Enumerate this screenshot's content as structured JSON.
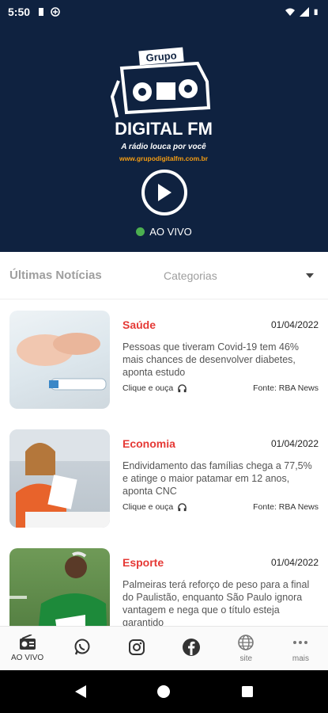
{
  "status_bar": {
    "time": "5:50"
  },
  "header": {
    "logo_text": "Grupo DIGITAL FM A rádio louca por você www.grupodigitalfm.com.br",
    "live_label": "AO VIVO"
  },
  "news_section": {
    "title": "Últimas Notícias",
    "categories_label": "Categorias"
  },
  "news": [
    {
      "category": "Saúde",
      "date": "01/04/2022",
      "text": "Pessoas que tiveram Covid-19 tem 46% mais chances de desenvolver diabetes, aponta estudo",
      "listen_label": "Clique e ouça",
      "source": "Fonte: RBA News"
    },
    {
      "category": "Economia",
      "date": "01/04/2022",
      "text": "Endividamento das famílias chega a 77,5% e atinge o maior patamar em 12 anos, aponta CNC",
      "listen_label": "Clique e ouça",
      "source": "Fonte: RBA News"
    },
    {
      "category": "Esporte",
      "date": "01/04/2022",
      "text": "Palmeiras terá reforço de peso para a final do Paulistão, enquanto São Paulo ignora vantagem e nega que o título esteja garantido",
      "listen_label": "",
      "source": ""
    }
  ],
  "bottom_nav": [
    {
      "label": "AO VIVO",
      "icon": "radio-icon"
    },
    {
      "label": "",
      "icon": "whatsapp-icon"
    },
    {
      "label": "",
      "icon": "instagram-icon"
    },
    {
      "label": "",
      "icon": "facebook-icon"
    },
    {
      "label": "site",
      "icon": "globe-icon"
    },
    {
      "label": "mais",
      "icon": "more-icon"
    }
  ],
  "colors": {
    "header_bg": "#0f2240",
    "accent_red": "#e53935",
    "live_green": "#4caf50",
    "logo_orange": "#f39c12"
  }
}
